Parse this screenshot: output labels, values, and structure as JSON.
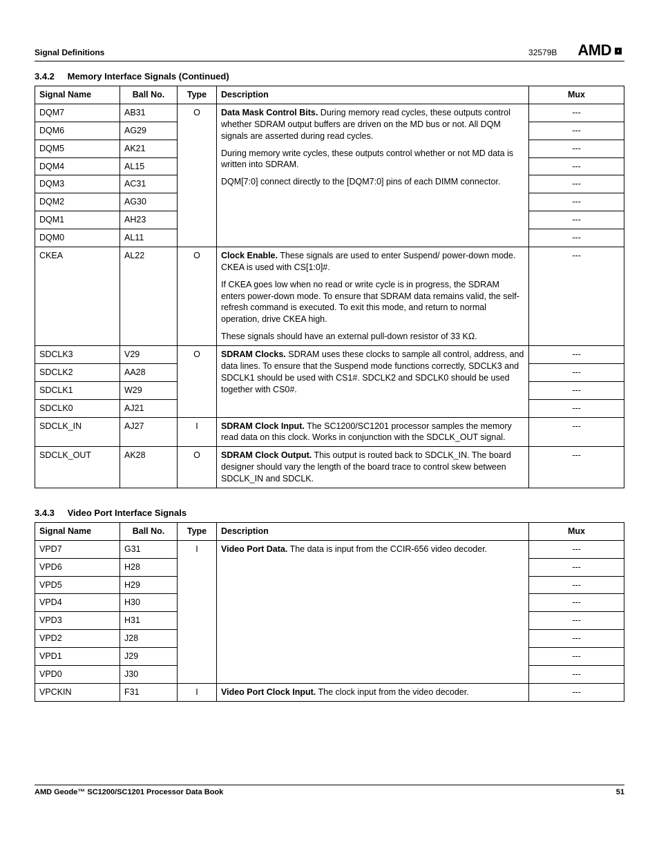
{
  "header": {
    "left": "Signal Definitions",
    "docnum": "32579B",
    "logo_text": "AMD"
  },
  "section1": {
    "num": "3.4.2",
    "title": "Memory Interface Signals",
    "cont": "(Continued)"
  },
  "table_headers": {
    "signal": "Signal Name",
    "ball": "Ball No.",
    "type": "Type",
    "desc": "Description",
    "mux": "Mux"
  },
  "t1": {
    "dqm7": {
      "s": "DQM7",
      "b": "AB31",
      "t": "O",
      "m": "---"
    },
    "dqm6": {
      "s": "DQM6",
      "b": "AG29",
      "m": "---"
    },
    "dqm5": {
      "s": "DQM5",
      "b": "AK21",
      "m": "---"
    },
    "dqm4": {
      "s": "DQM4",
      "b": "AL15",
      "m": "---"
    },
    "dqm3": {
      "s": "DQM3",
      "b": "AC31",
      "m": "---"
    },
    "dqm2": {
      "s": "DQM2",
      "b": "AG30",
      "m": "---"
    },
    "dqm1": {
      "s": "DQM1",
      "b": "AH23",
      "m": "---"
    },
    "dqm0": {
      "s": "DQM0",
      "b": "AL11",
      "m": "---"
    },
    "dqm_desc_bold": "Data Mask Control Bits.",
    "dqm_desc_p1": " During memory read cycles, these outputs control whether SDRAM output buffers are driven on the MD bus or not. All DQM signals are asserted during read cycles.",
    "dqm_desc_p2": "During memory write cycles, these outputs control whether or not MD data is written into SDRAM.",
    "dqm_desc_p3": "DQM[7:0] connect directly to the [DQM7:0] pins of each DIMM connector.",
    "ckea": {
      "s": "CKEA",
      "b": "AL22",
      "t": "O",
      "m": "---"
    },
    "ckea_bold": "Clock Enable.",
    "ckea_p1": " These signals are used to enter Suspend/ power-down mode. CKEA is used with CS[1:0]#.",
    "ckea_p2": "If CKEA goes low when no read or write cycle is in progress, the SDRAM enters power-down mode. To ensure that SDRAM data remains valid, the self-refresh command is executed. To exit this mode, and return to normal operation, drive CKEA high.",
    "ckea_p3": "These signals should have an external pull-down resistor of 33 KΩ.",
    "sdclk3": {
      "s": "SDCLK3",
      "b": "V29",
      "t": "O",
      "m": "---"
    },
    "sdclk2": {
      "s": "SDCLK2",
      "b": "AA28",
      "m": "---"
    },
    "sdclk1": {
      "s": "SDCLK1",
      "b": "W29",
      "m": "---"
    },
    "sdclk0": {
      "s": "SDCLK0",
      "b": "AJ21",
      "m": "---"
    },
    "sdclk_bold": "SDRAM Clocks.",
    "sdclk_p1": " SDRAM uses these clocks to sample all control, address, and data lines. To ensure that the Suspend mode functions correctly, SDCLK3 and SDCLK1 should be used with CS1#. SDCLK2 and SDCLK0 should be used together with CS0#.",
    "sdclk_in": {
      "s": "SDCLK_IN",
      "b": "AJ27",
      "t": "I",
      "m": "---"
    },
    "sdclk_in_bold": "SDRAM Clock Input.",
    "sdclk_in_p1": " The SC1200/SC1201 processor samples the memory read data on this clock. Works in conjunction with the SDCLK_OUT signal.",
    "sdclk_out": {
      "s": "SDCLK_OUT",
      "b": "AK28",
      "t": "O",
      "m": "---"
    },
    "sdclk_out_bold": "SDRAM Clock Output.",
    "sdclk_out_p1": " This output is routed back to SDCLK_IN. The board designer should vary the length of the board trace to control skew between SDCLK_IN and SDCLK."
  },
  "section2": {
    "num": "3.4.3",
    "title": "Video Port Interface Signals"
  },
  "t2": {
    "vpd7": {
      "s": "VPD7",
      "b": "G31",
      "t": "I",
      "m": "---"
    },
    "vpd6": {
      "s": "VPD6",
      "b": "H28",
      "m": "---"
    },
    "vpd5": {
      "s": "VPD5",
      "b": "H29",
      "m": "---"
    },
    "vpd4": {
      "s": "VPD4",
      "b": "H30",
      "m": "---"
    },
    "vpd3": {
      "s": "VPD3",
      "b": "H31",
      "m": "---"
    },
    "vpd2": {
      "s": "VPD2",
      "b": "J28",
      "m": "---"
    },
    "vpd1": {
      "s": "VPD1",
      "b": "J29",
      "m": "---"
    },
    "vpd0": {
      "s": "VPD0",
      "b": "J30",
      "m": "---"
    },
    "vpd_bold": "Video Port Data.",
    "vpd_p1": " The data is input from the CCIR-656 video decoder.",
    "vpckin": {
      "s": "VPCKIN",
      "b": "F31",
      "t": "I",
      "m": "---"
    },
    "vpckin_bold": "Video Port Clock Input.",
    "vpckin_p1": " The clock input from the video decoder."
  },
  "footer": {
    "left": "AMD Geode™ SC1200/SC1201 Processor Data Book",
    "right": "51"
  }
}
